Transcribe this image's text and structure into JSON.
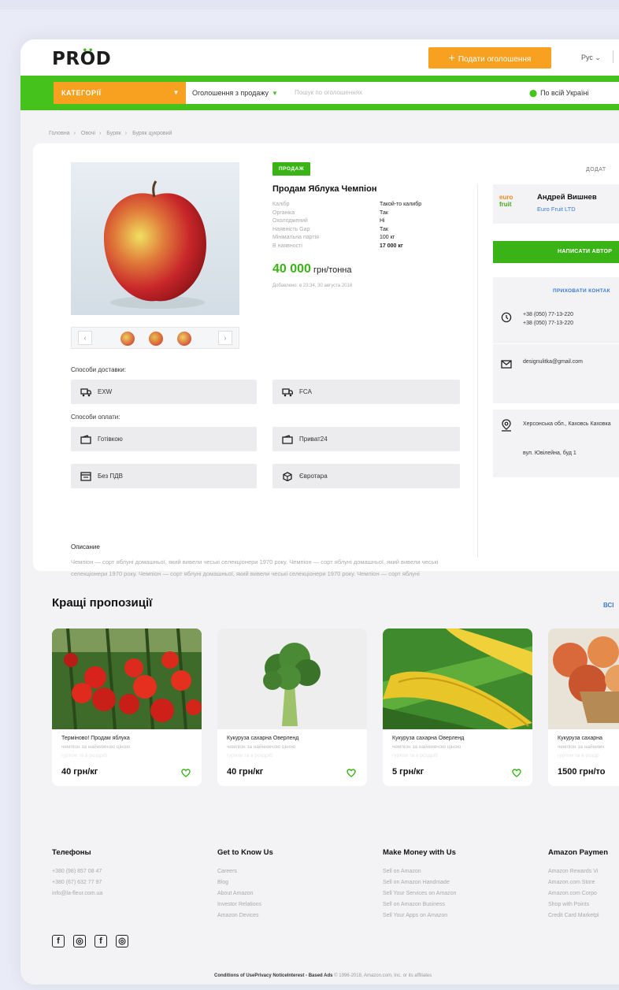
{
  "header": {
    "logo": "PROD",
    "post_button": "Подати оголошення",
    "lang": "Рус"
  },
  "searchbar": {
    "category_button": "КАТЕГОРІЇ",
    "listing_type": "Оголошення з продажу",
    "search_placeholder": "Пошук по оголошеннях",
    "region": "По всій Україні"
  },
  "breadcrumb": [
    "Головна",
    "Овочі",
    "Буряк",
    "Буряк цукровий"
  ],
  "product": {
    "badge": "ПРОДАЖ",
    "title": "Продам Яблука Чемпіон",
    "attributes": [
      {
        "key": "Калібр",
        "value": "Такой-то калибр"
      },
      {
        "key": "Органіка",
        "value": "Так"
      },
      {
        "key": "Охолоджений",
        "value": "Ні"
      },
      {
        "key": "Наявність Gap",
        "value": "Так"
      },
      {
        "key": "Мінімальна партія",
        "value": "100 кг"
      },
      {
        "key": "В наявності",
        "value": "17 000 кг"
      }
    ],
    "price": "40 000",
    "price_unit": "грн/тонна",
    "added": "Добавлено: в 23:34, 30 августа 2018"
  },
  "delivery": {
    "label": "Способи доставки:",
    "options": [
      "EXW",
      "FCA"
    ]
  },
  "payment": {
    "label": "Способи оплати:",
    "options": [
      "Готівкою",
      "Приват24",
      "Без ПДВ",
      "Євротара"
    ]
  },
  "description": {
    "title": "Описание",
    "text": "Чемпіон — сорт яблуні домашньої, який вивели чеські селекціонери 1970 року. Чемпіон — сорт яблуні домашньої, який вивели чеські селекціонери 1970 року. Чемпіон — сорт яблуні домашньої, який вивели чеські селекціонери 1970 року. Чемпіон — сорт яблуні"
  },
  "seller": {
    "add_link": "ДОДАТ",
    "logo_text_1": "euro",
    "logo_text_2": "fruit",
    "name": "Андрей Вишнев",
    "company": "Euro Fruit LTD",
    "write_button": "НАПИСАТИ АВТОР",
    "hide_contacts": "ПРИХОВАТИ КОНТАК",
    "phones": [
      "+38 (050) 77-13-220",
      "+38 (050) 77-13-220"
    ],
    "email": "designulitka@gmail.com",
    "location": "Херсонська обл., Каховсь Каховка",
    "street": "вул. Ювілейна, буд 1"
  },
  "best": {
    "title": "Кращі пропозиції",
    "all_link": "ВСІ",
    "items": [
      {
        "name": "Терміново! Продам яблука",
        "sub": "чемпіон за найнижчою ціною",
        "sub2": "гуртом та в роздріб",
        "price": "40 грн/кг"
      },
      {
        "name": "Кукуруза сахарна Оверленд",
        "sub": "чемпіон за найнижчою ціною",
        "sub2": "гуртом та в роздріб",
        "price": "40 грн/кг"
      },
      {
        "name": "Кукуруза сахарна Оверленд",
        "sub": "чемпіон за найнижчою ціною",
        "sub2": "гуртом та в роздріб",
        "price": "5 грн/кг"
      },
      {
        "name": "Кукуруза сахарна",
        "sub": "чемпіон за найнижч",
        "sub2": "гуртом та в роздр",
        "price": "1500 грн/то"
      }
    ]
  },
  "footer": {
    "columns": [
      {
        "title": "Телефоны",
        "items": [
          "+380 (98) 857 08 47",
          "+380 (67) 632 77 97",
          "info@la-fleur.com.ua"
        ]
      },
      {
        "title": "Get to Know Us",
        "items": [
          "Careers",
          "Blog",
          "About Amazon",
          "Investor Relations",
          "Amazon Devices"
        ]
      },
      {
        "title": "Make Money with Us",
        "items": [
          "Sell on Amazon",
          "Sell on Amazon Handmade",
          "Sell Your Services on Amazon",
          "Sell on Amazon Business",
          "Sell Your Apps on Amazon"
        ]
      },
      {
        "title": "Amazon Paymen",
        "items": [
          "Amazon Rewards Vi",
          "Amazon.com Store",
          "Amazon.com Corpo",
          "Shop with Points",
          "Credit Card Marketpl"
        ]
      }
    ],
    "social": [
      "f",
      "◎",
      "f",
      "◎"
    ],
    "copyright_links": "Conditions of UsePrivacy NoticeInterest - Based Ads",
    "copyright_text": "© 1996-2018, Amazon.com, Inc. or its affiliates"
  },
  "colors": {
    "green": "#46c21d",
    "orange": "#f8a01f",
    "blue": "#3a7ad6"
  }
}
